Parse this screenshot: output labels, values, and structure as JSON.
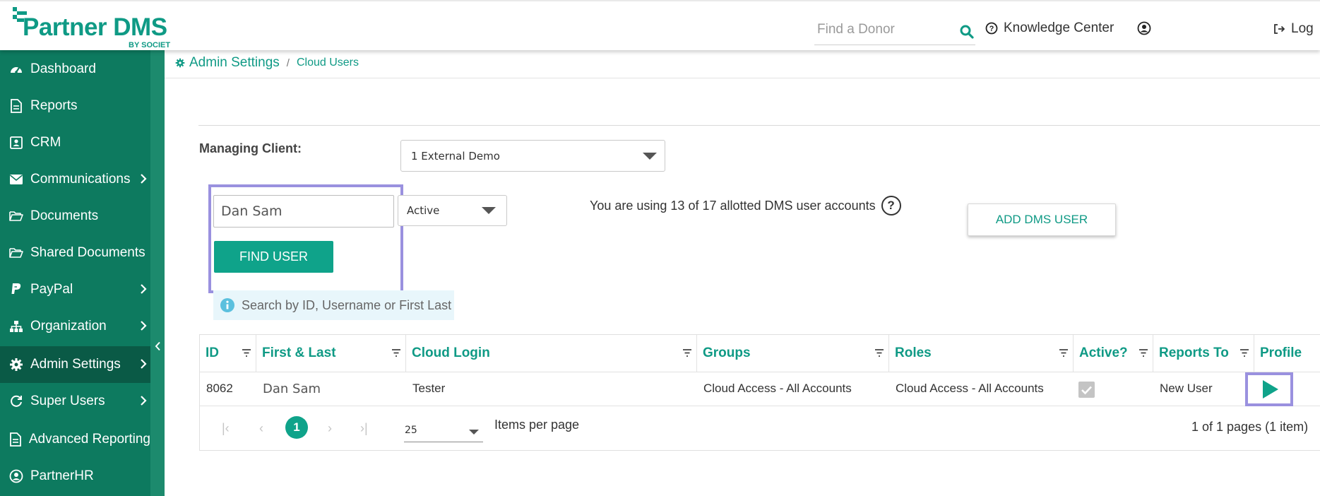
{
  "brand": {
    "name": "Partner DMS",
    "tagline": "BY SOCIET",
    "color": "#0f9a85"
  },
  "header": {
    "search_placeholder": "Find a Donor",
    "knowledge_center": "Knowledge Center",
    "logout": "Log"
  },
  "sidebar": {
    "items": [
      {
        "label": "Dashboard",
        "icon": "dashboard-icon"
      },
      {
        "label": "Reports",
        "icon": "document-icon"
      },
      {
        "label": "CRM",
        "icon": "contact-card-icon"
      },
      {
        "label": "Communications",
        "icon": "envelope-icon",
        "has_submenu": true
      },
      {
        "label": "Documents",
        "icon": "folder-open-icon"
      },
      {
        "label": "Shared Documents",
        "icon": "folder-open-icon"
      },
      {
        "label": "PayPal",
        "icon": "paypal-icon",
        "has_submenu": true
      },
      {
        "label": "Organization",
        "icon": "sitemap-icon",
        "has_submenu": true
      },
      {
        "label": "Admin Settings",
        "icon": "gear-icon",
        "has_submenu": true,
        "active": true
      },
      {
        "label": "Super Users",
        "icon": "refresh-icon",
        "has_submenu": true
      },
      {
        "label": "Advanced Reporting",
        "icon": "document-icon"
      },
      {
        "label": "PartnerHR",
        "icon": "user-circle-icon"
      }
    ]
  },
  "breadcrumb": {
    "root": "Admin Settings",
    "separator": "/",
    "current": "Cloud Users"
  },
  "managing_client": {
    "label": "Managing Client:",
    "selected": "1 External Demo"
  },
  "search": {
    "value": "Dan Sam",
    "status_selected": "Active",
    "find_button": "FIND USER",
    "hint": "Search by ID, Username or First Last"
  },
  "usage_text": "You are using 13 of 17 allotted DMS user accounts",
  "help_glyph": "?",
  "add_user_button": "ADD DMS USER",
  "table": {
    "columns": [
      "ID",
      "First & Last",
      "Cloud Login",
      "Groups",
      "Roles",
      "Active?",
      "Reports To",
      "Profile"
    ],
    "rows": [
      {
        "id": "8062",
        "name": "Dan Sam",
        "login": "Tester",
        "groups": "Cloud Access - All Accounts",
        "roles": "Cloud Access - All Accounts",
        "active": true,
        "reports_to": "New User"
      }
    ]
  },
  "pagination": {
    "current_page": "1",
    "page_size": "25",
    "items_per_page_label": "Items per page",
    "summary": "1 of 1 pages (1 item)"
  }
}
